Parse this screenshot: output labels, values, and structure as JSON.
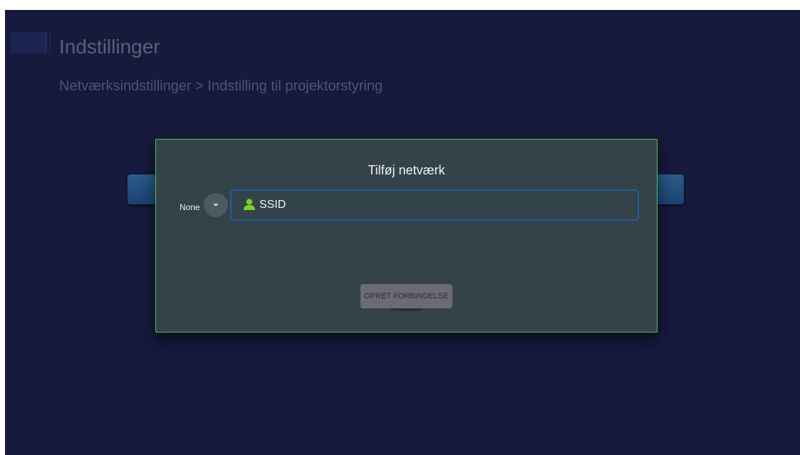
{
  "header": {
    "title": "Indstillinger",
    "breadcrumb": "Netværksindstillinger > Indstilling til projektorstyring"
  },
  "dialog": {
    "title": "Tilføj netværk",
    "security_value": "None",
    "ssid_placeholder": "SSID",
    "connect_label": "OPRET FORBINDELSE"
  },
  "icons": {
    "user": "user-icon",
    "dropdown": "chevron-down-icon"
  },
  "colors": {
    "background": "#161a3d",
    "dialog_bg": "#34434a",
    "dialog_border": "#3ecb3e",
    "field_border": "#1f5f9e",
    "user_icon": "#7ed321"
  }
}
